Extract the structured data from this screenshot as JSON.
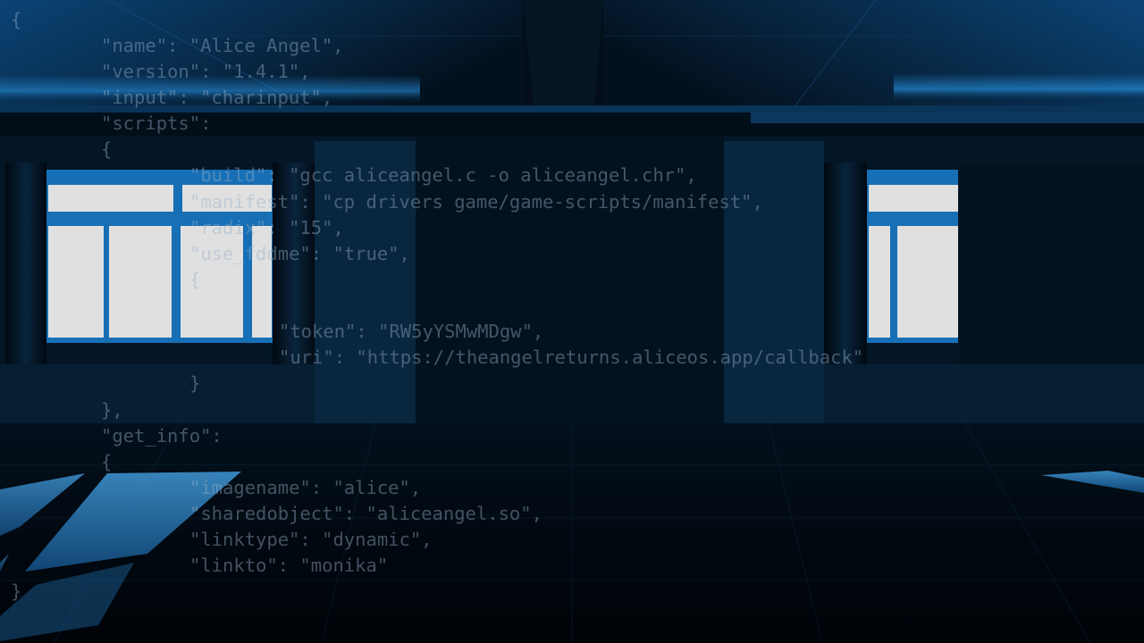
{
  "scene": {
    "name": "empty-classroom-night",
    "colors": {
      "accent": "#1e8fe6",
      "window_glow": "#ffffff",
      "wall": "#062238",
      "floor": "#02080f",
      "code_text": "#96afc8"
    }
  },
  "code": {
    "lines": [
      "{",
      "\"name\": \"Alice Angel\",",
      "\"version\": \"1.4.1\",",
      "\"input\": \"charinput\",",
      "\"scripts\":",
      "{",
      "\"build\": \"gcc aliceangel.c -o aliceangel.chr\",",
      "\"manifest\": \"cp drivers game/game-scripts/manifest\",",
      "\"radix\": \"15\",",
      "\"use_fddme\": \"true\",",
      "{",
      "\"token\": \"RW5yYSMwMDgw\",",
      "\"uri\": \"https://theangelreturns.aliceos.app/callback\"",
      "}",
      "},",
      "\"get_info\":",
      "{",
      "\"imagename\": \"alice\",",
      "\"sharedobject\": \"aliceangel.so\",",
      "\"linktype\": \"dynamic\",",
      "\"linkto\": \"monika\"",
      "}"
    ]
  }
}
